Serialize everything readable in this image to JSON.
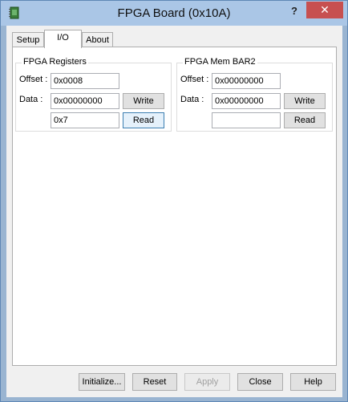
{
  "window": {
    "title": "FPGA Board (0x10A)",
    "help": "?",
    "close": "✕",
    "icon": "app-icon"
  },
  "tabs": [
    {
      "label": "Setup"
    },
    {
      "label": "I/O",
      "active": true
    },
    {
      "label": "About"
    }
  ],
  "registers": {
    "title": "FPGA Registers",
    "offset_label": "Offset :",
    "offset_value": "0x0008",
    "data_label": "Data :",
    "data_value": "0x00000000",
    "read_value": "0x7",
    "write_label": "Write",
    "read_label": "Read"
  },
  "membar": {
    "title": "FPGA Mem BAR2",
    "offset_label": "Offset :",
    "offset_value": "0x00000000",
    "data_label": "Data :",
    "data_value": "0x00000000",
    "read_value": "",
    "write_label": "Write",
    "read_label": "Read"
  },
  "footer": {
    "initialize": "Initialize...",
    "reset": "Reset",
    "apply": "Apply",
    "close": "Close",
    "help": "Help"
  }
}
